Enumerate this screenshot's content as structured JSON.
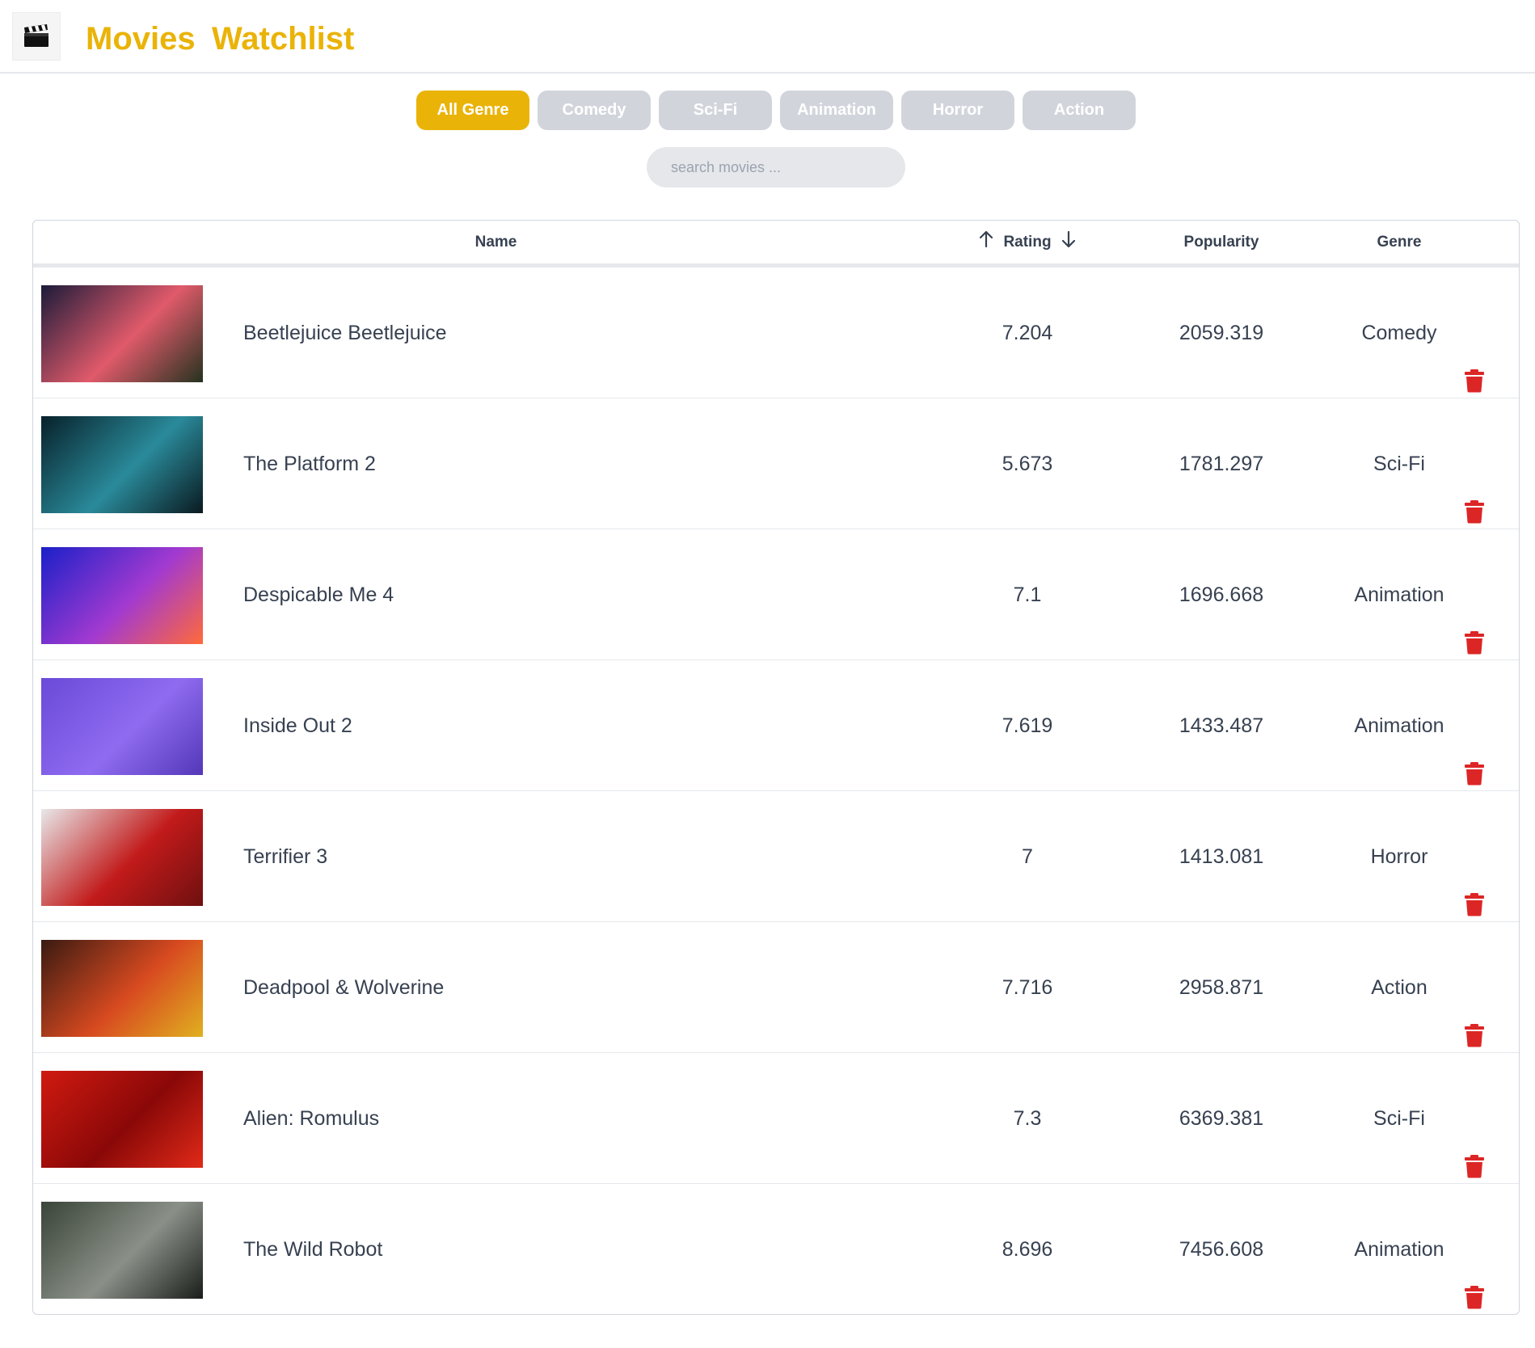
{
  "header": {
    "logo_icon": "clapperboard-icon",
    "title_1": "Movies",
    "title_2": "Watchlist",
    "brand_color": "#eab308"
  },
  "genres": [
    {
      "label": "All Genre",
      "active": true
    },
    {
      "label": "Comedy",
      "active": false
    },
    {
      "label": "Sci-Fi",
      "active": false
    },
    {
      "label": "Animation",
      "active": false
    },
    {
      "label": "Horror",
      "active": false
    },
    {
      "label": "Action",
      "active": false
    }
  ],
  "search": {
    "placeholder": "search movies ..."
  },
  "table": {
    "columns": {
      "name": "Name",
      "rating": "Rating",
      "popularity": "Popularity",
      "genre": "Genre"
    },
    "sort_up_icon": "arrow-up-icon",
    "sort_down_icon": "arrow-down-icon",
    "delete_icon": "trash-icon",
    "delete_color": "#dc2626",
    "rows": [
      {
        "name": "Beetlejuice Beetlejuice",
        "rating": "7.204",
        "popularity": "2059.319",
        "genre": "Comedy",
        "poster_colors": [
          "#1b1b3a",
          "#e05a6a",
          "#24331f"
        ]
      },
      {
        "name": "The Platform 2",
        "rating": "5.673",
        "popularity": "1781.297",
        "genre": "Sci-Fi",
        "poster_colors": [
          "#07212a",
          "#2a8a9a",
          "#0a1a20"
        ]
      },
      {
        "name": "Despicable Me 4",
        "rating": "7.1",
        "popularity": "1696.668",
        "genre": "Animation",
        "poster_colors": [
          "#1a20c8",
          "#a23ad0",
          "#ff6a3a"
        ]
      },
      {
        "name": "Inside Out 2",
        "rating": "7.619",
        "popularity": "1433.487",
        "genre": "Animation",
        "poster_colors": [
          "#6a4ad8",
          "#8f6bf0",
          "#5338b8"
        ]
      },
      {
        "name": "Terrifier 3",
        "rating": "7",
        "popularity": "1413.081",
        "genre": "Horror",
        "poster_colors": [
          "#e8e8ea",
          "#c21a1a",
          "#6e1010"
        ]
      },
      {
        "name": "Deadpool & Wolverine",
        "rating": "7.716",
        "popularity": "2958.871",
        "genre": "Action",
        "poster_colors": [
          "#3a1a12",
          "#d84a20",
          "#e0b020"
        ]
      },
      {
        "name": "Alien: Romulus",
        "rating": "7.3",
        "popularity": "6369.381",
        "genre": "Sci-Fi",
        "poster_colors": [
          "#d01a10",
          "#8a0808",
          "#e02a18"
        ]
      },
      {
        "name": "The Wild Robot",
        "rating": "8.696",
        "popularity": "7456.608",
        "genre": "Animation",
        "poster_colors": [
          "#3a4438",
          "#8a9088",
          "#1a1e1a"
        ]
      }
    ]
  }
}
